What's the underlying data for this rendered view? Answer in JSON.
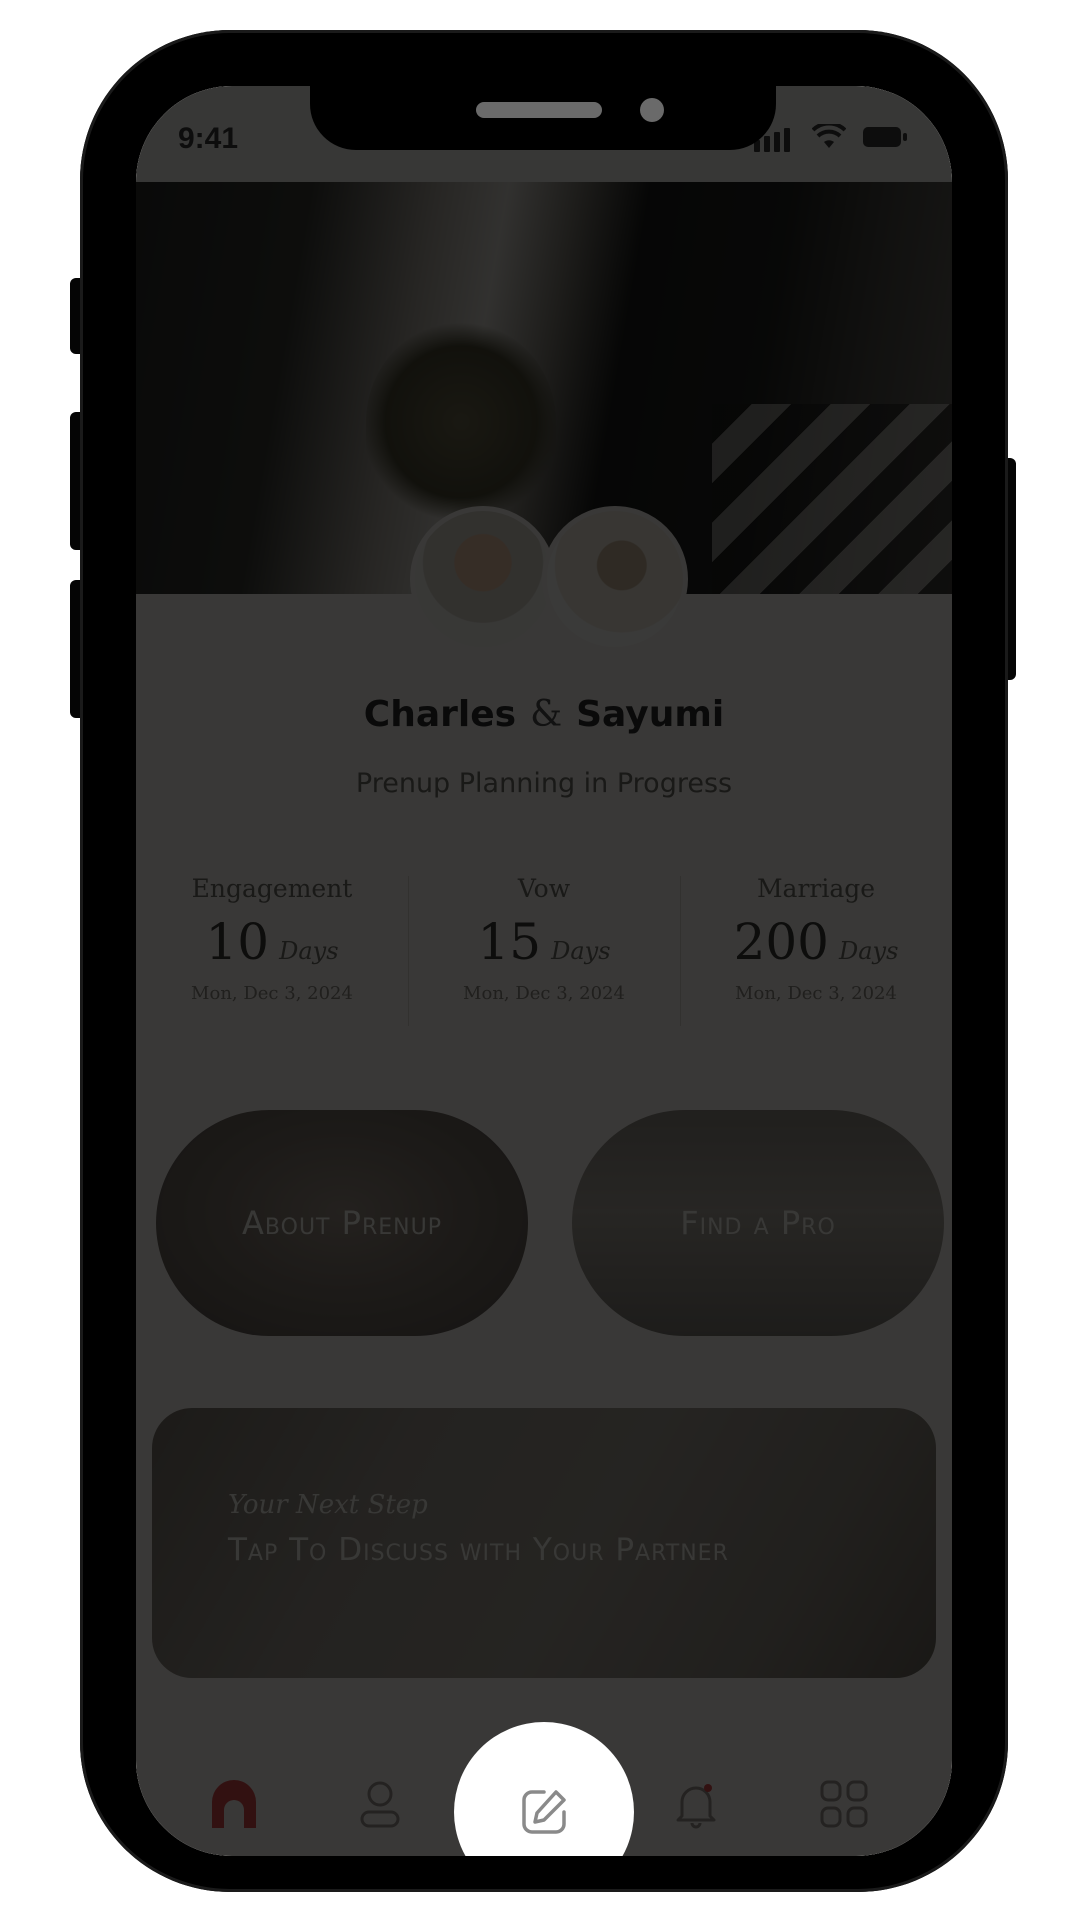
{
  "status_bar": {
    "time": "9:41"
  },
  "couple": {
    "name_left": "Charles",
    "ampersand": "&",
    "name_right": "Sayumi"
  },
  "subtitle": "Prenup Planning in Progress",
  "stats": [
    {
      "label": "Engagement",
      "value": "10",
      "unit": "Days",
      "date": "Mon, Dec 3, 2024"
    },
    {
      "label": "Vow",
      "value": "15",
      "unit": "Days",
      "date": "Mon, Dec 3, 2024"
    },
    {
      "label": "Marriage",
      "value": "200",
      "unit": "Days",
      "date": "Mon, Dec 3, 2024"
    }
  ],
  "cards": {
    "about": "About Prenup",
    "find_pro": "Find a Pro"
  },
  "next_step": {
    "kicker": "Your Next Step",
    "title": "Tap To Discuss with Your Partner"
  },
  "tabs": [
    {
      "icon": "home-icon"
    },
    {
      "icon": "profile-icon"
    },
    {
      "icon": "edit-icon"
    },
    {
      "icon": "bell-icon"
    },
    {
      "icon": "grid-icon"
    }
  ],
  "colors": {
    "accent": "#d94a4a",
    "overlay": "rgba(0,0,0,0.77)"
  }
}
